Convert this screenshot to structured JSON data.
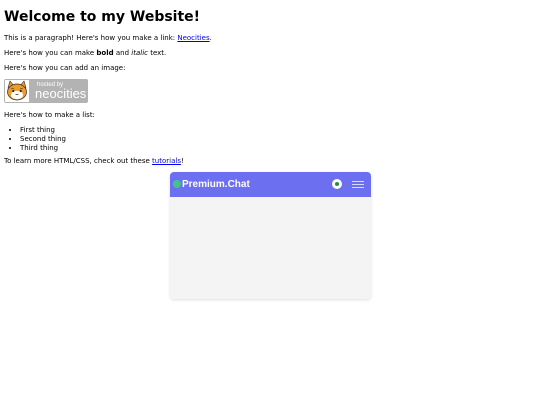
{
  "page": {
    "heading": "Welcome to my Website!",
    "para1_text": "This is a paragraph! Here's how you make a link: ",
    "para1_link": "Neocities",
    "para1_end": ".",
    "para2_pre": "Here's how you can make ",
    "para2_bold": "bold",
    "para2_mid": " and ",
    "para2_italic": "italic",
    "para2_end": " text.",
    "para3": "Here's how you can add an image:",
    "badge": {
      "small_text": "hosted by",
      "big_text": "neocities"
    },
    "para4": "Here's how to make a list:",
    "list_items": [
      "First thing",
      "Second thing",
      "Third thing"
    ],
    "para5_pre": "To learn more HTML/CSS, check out these ",
    "para5_link": "tutorials",
    "para5_end": "!"
  },
  "chat_widget": {
    "title": "Premium.Chat",
    "header_color": "#6b6ff0",
    "status_color": "#2a8a46",
    "logo_icon": "chat-logo-icon",
    "menu_icon": "hamburger-menu-icon"
  }
}
